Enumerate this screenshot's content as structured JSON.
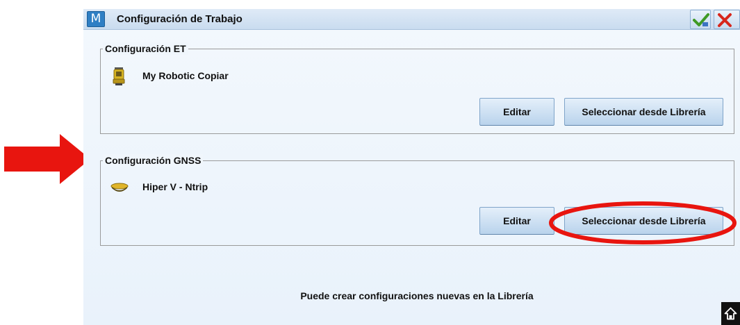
{
  "window": {
    "title": "Configuración de Trabajo",
    "logo_letter": "M"
  },
  "titlebar_buttons": {
    "accept_icon": "checkmark-icon",
    "cancel_icon": "close-icon"
  },
  "et_group": {
    "title": "Configuración ET",
    "device_icon": "total-station-icon",
    "device_name": "My Robotic Copiar",
    "edit_label": "Editar",
    "library_label": "Seleccionar desde Librería"
  },
  "gnss_group": {
    "title": "Configuración GNSS",
    "device_icon": "gnss-receiver-icon",
    "device_name": "Hiper V - Ntrip",
    "edit_label": "Editar",
    "library_label": "Seleccionar desde Librería"
  },
  "footer": {
    "message": "Puede crear configuraciones nuevas en la Librería",
    "home_icon": "home-icon"
  },
  "annotations": {
    "arrow_color": "#e8150f",
    "ellipse_color": "#e8150f"
  },
  "colors": {
    "background": "#eef5fc",
    "titlebar": "#c9dcef",
    "button": "#b9d3ec"
  }
}
